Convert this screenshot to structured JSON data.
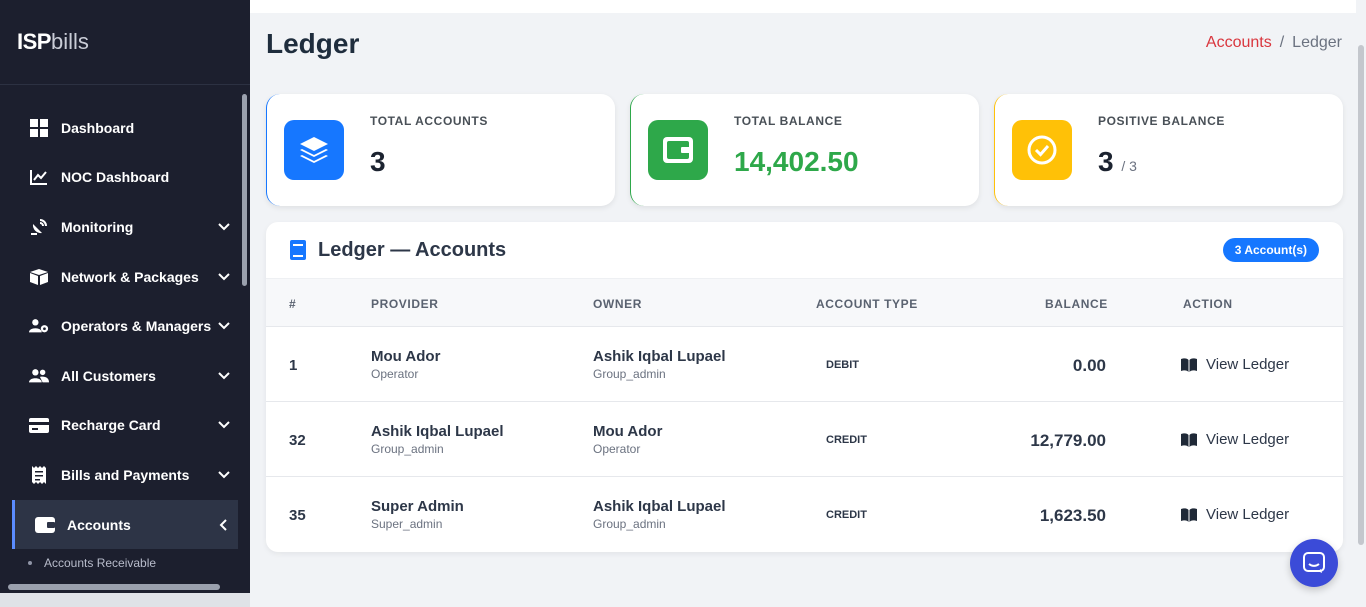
{
  "brand": {
    "part1": "ISP",
    "part2": "bills"
  },
  "sidebar": {
    "items": [
      {
        "label": "Dashboard",
        "icon": "grid-icon",
        "has_chevron": false
      },
      {
        "label": "NOC Dashboard",
        "icon": "chart-line-icon",
        "has_chevron": false
      },
      {
        "label": "Monitoring",
        "icon": "satellite-dish-icon",
        "has_chevron": true
      },
      {
        "label": "Network & Packages",
        "icon": "boxes-icon",
        "has_chevron": true
      },
      {
        "label": "Operators & Managers",
        "icon": "users-cog-icon",
        "has_chevron": true
      },
      {
        "label": "All Customers",
        "icon": "users-icon",
        "has_chevron": true
      },
      {
        "label": "Recharge Card",
        "icon": "credit-card-icon",
        "has_chevron": true
      },
      {
        "label": "Bills and Payments",
        "icon": "receipt-icon",
        "has_chevron": true
      },
      {
        "label": "Accounts",
        "icon": "wallet-icon",
        "has_chevron": true,
        "active": true
      }
    ],
    "subitem": "Accounts Receivable"
  },
  "page": {
    "title": "Ledger",
    "breadcrumb": {
      "link": "Accounts",
      "sep": "/",
      "current": "Ledger"
    }
  },
  "stats": [
    {
      "label": "TOTAL ACCOUNTS",
      "value": "3",
      "icon": "layers-icon",
      "color": "#1677ff"
    },
    {
      "label": "TOTAL BALANCE",
      "value": "14,402.50",
      "icon": "wallet-icon",
      "color": "#2ea84a"
    },
    {
      "label": "POSITIVE BALANCE",
      "value": "3",
      "suffix": "/ 3",
      "icon": "check-circle-icon",
      "color": "#ffc107"
    }
  ],
  "ledger": {
    "title": "Ledger — Accounts",
    "badge": "3 Account(s)",
    "columns": [
      "#",
      "PROVIDER",
      "OWNER",
      "ACCOUNT TYPE",
      "BALANCE",
      "ACTION"
    ],
    "rows": [
      {
        "id": "1",
        "provider": "Mou Ador",
        "provider_role": "Operator",
        "owner": "Ashik Iqbal Lupael",
        "owner_role": "Group_admin",
        "type": "DEBIT",
        "balance": "0.00",
        "action": "View Ledger"
      },
      {
        "id": "32",
        "provider": "Ashik Iqbal Lupael",
        "provider_role": "Group_admin",
        "owner": "Mou Ador",
        "owner_role": "Operator",
        "type": "CREDIT",
        "balance": "12,779.00",
        "action": "View Ledger"
      },
      {
        "id": "35",
        "provider": "Super Admin",
        "provider_role": "Super_admin",
        "owner": "Ashik Iqbal Lupael",
        "owner_role": "Group_admin",
        "type": "CREDIT",
        "balance": "1,623.50",
        "action": "View Ledger"
      }
    ]
  },
  "colors": {
    "sidebar_bg": "#1c1f2e",
    "accent_red": "#d9363e",
    "primary": "#1677ff",
    "chat": "#3b4bd8"
  }
}
